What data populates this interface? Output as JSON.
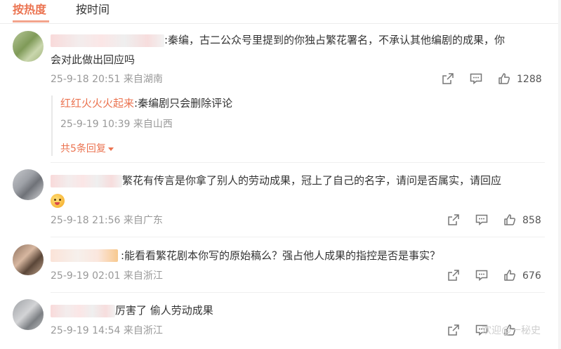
{
  "tabs": {
    "hot": "按热度",
    "time": "按时间"
  },
  "comments": [
    {
      "text_line1": ":秦编，古二公众号里提到的你独占繁花署名，不承认其他编剧的成果，你",
      "text_line2": "会对此做出回应吗",
      "time": "25-9-18 20:51 来自湖南",
      "likes": "1288",
      "reply": {
        "name": "红红火火火起来",
        "text": ":秦编剧只会删除评论",
        "time": "25-9-19 10:39 来自山西",
        "more": "共5条回复"
      }
    },
    {
      "text_line1": "繁花有传言是你拿了别人的劳动成果，冠上了自己的名字，请问是否属实，请回应",
      "time": "25-9-18 21:56 来自广东",
      "likes": "858"
    },
    {
      "text_line1": ":能看看繁花剧本你写的原始稿么？强占他人成果的指控是否是事实？",
      "time": "25-9-19 02:01 来自浙江",
      "likes": "676"
    },
    {
      "text_line1": "厉害了  偷人劳动成果",
      "time": "25-9-19 14:54 来自浙江",
      "likes": ""
    }
  ],
  "watermark": "欢迎@一秘史",
  "colors": {
    "accent": "#eb7350",
    "meta": "#999999",
    "text": "#333333"
  }
}
